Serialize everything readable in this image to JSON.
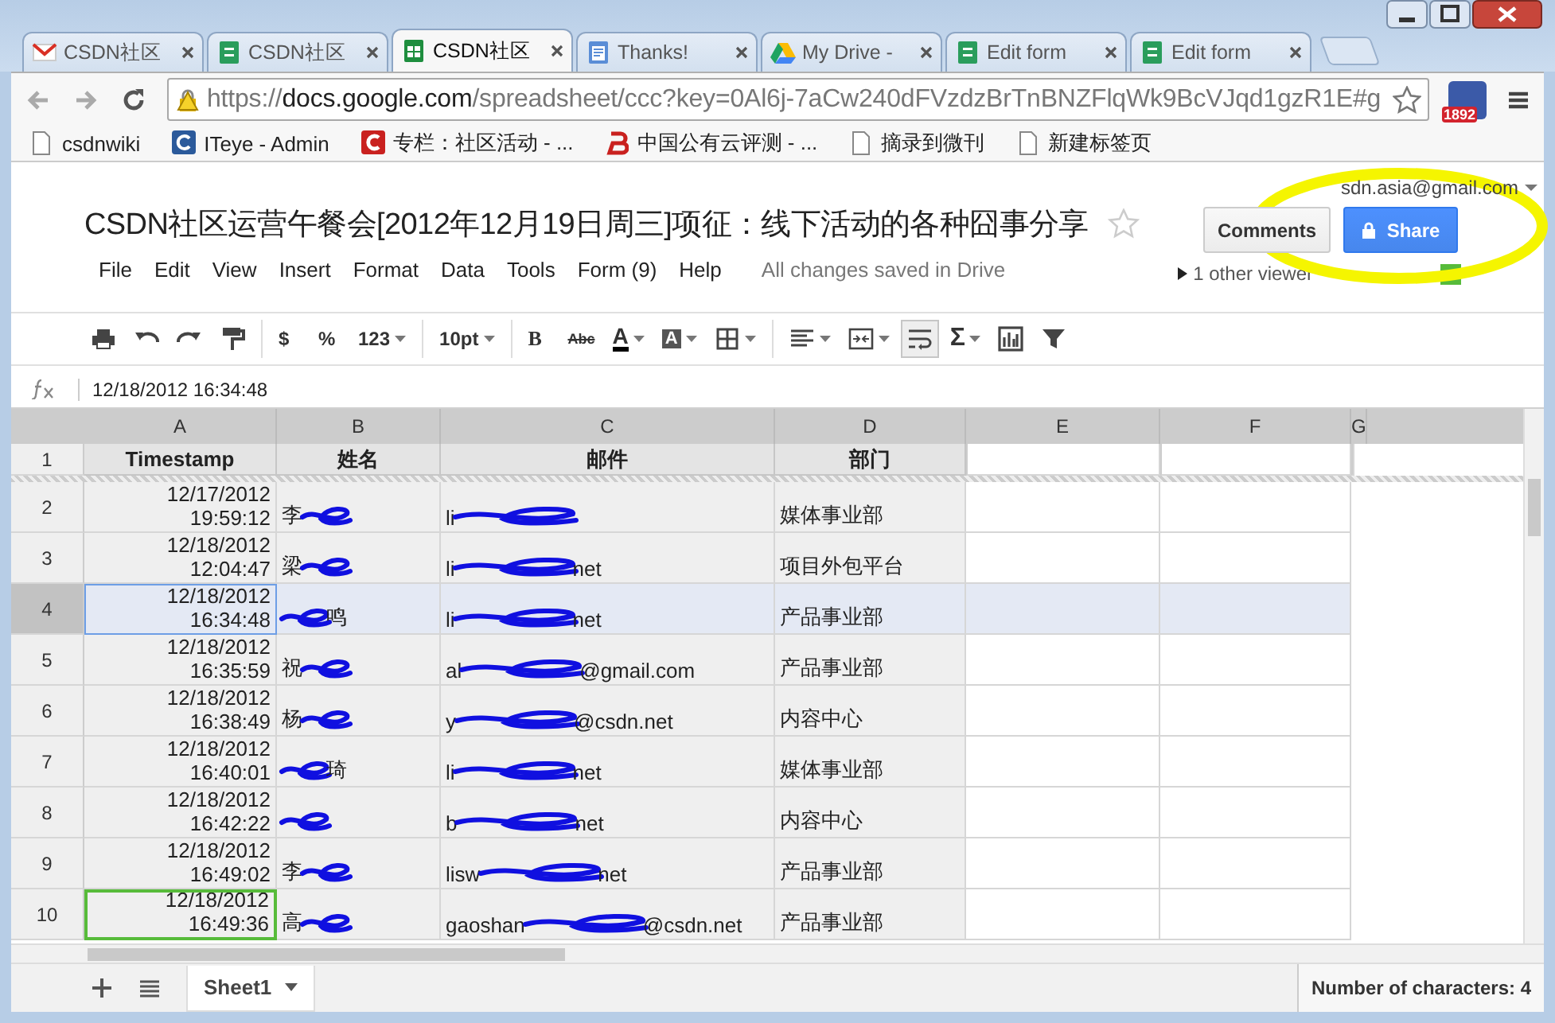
{
  "browser": {
    "tabs": [
      {
        "kind": "gmail",
        "label": "CSDN社区",
        "selected": false
      },
      {
        "kind": "forms",
        "label": "CSDN社区",
        "selected": false
      },
      {
        "kind": "sheets",
        "label": "CSDN社区",
        "selected": true
      },
      {
        "kind": "docs",
        "label": "Thanks!",
        "selected": false
      },
      {
        "kind": "drive",
        "label": "My Drive -",
        "selected": false
      },
      {
        "kind": "forms",
        "label": "Edit form",
        "selected": false
      },
      {
        "kind": "forms",
        "label": "Edit form",
        "selected": false
      }
    ],
    "url_scheme": "https://",
    "url_host": "docs.google.com",
    "url_path": "/spreadsheet/ccc?key=0Al6j-7aCw240dFVzdzBrTnBNZFlqWk9BcVJqd1gzR1E#g",
    "extension_badge": "1892",
    "bookmarks": [
      {
        "kind": "page",
        "label": "csdnwiki"
      },
      {
        "kind": "iteye",
        "label": "ITeye - Admin"
      },
      {
        "kind": "csdn",
        "label": "专栏：社区活动 - ..."
      },
      {
        "kind": "b",
        "label": "中国公有云评测 - ..."
      },
      {
        "kind": "page",
        "label": "摘录到微刊"
      },
      {
        "kind": "page",
        "label": "新建标签页"
      }
    ]
  },
  "docs": {
    "account": "sdn.asia@gmail.com",
    "title": "CSDN社区运营午餐会[2012年12月19日周三]项征：线下活动的各种囧事分享",
    "comments_button": "Comments",
    "share_button": "Share",
    "menus": [
      "File",
      "Edit",
      "View",
      "Insert",
      "Format",
      "Data",
      "Tools",
      "Form (9)",
      "Help"
    ],
    "save_status": "All changes saved in Drive",
    "viewers": "1 other viewer"
  },
  "toolbar": [
    [
      {
        "kind": "print",
        "pressed": false
      },
      {
        "kind": "undo",
        "pressed": false
      },
      {
        "kind": "redo",
        "pressed": false
      },
      {
        "kind": "paint",
        "pressed": false
      }
    ],
    [
      {
        "kind": "text",
        "label": "$",
        "pressed": false
      },
      {
        "kind": "text",
        "label": "%",
        "pressed": false
      },
      {
        "kind": "dropdown",
        "label": "123",
        "pressed": false
      }
    ],
    [
      {
        "kind": "dropdown",
        "label": "10pt",
        "pressed": false
      }
    ],
    [
      {
        "kind": "bold",
        "label": "B",
        "pressed": false
      },
      {
        "kind": "strike",
        "label": "Abc",
        "pressed": false
      },
      {
        "kind": "textcolor",
        "label": "A",
        "pressed": false
      },
      {
        "kind": "fillcolor",
        "label": "A",
        "pressed": false
      },
      {
        "kind": "borders",
        "pressed": false
      }
    ],
    [
      {
        "kind": "align",
        "pressed": false
      },
      {
        "kind": "merge",
        "pressed": false
      },
      {
        "kind": "wrap",
        "pressed": true
      },
      {
        "kind": "sum",
        "label": "Σ",
        "pressed": false
      },
      {
        "kind": "chart",
        "pressed": false
      },
      {
        "kind": "filter",
        "pressed": false
      }
    ]
  ],
  "formula_bar": {
    "value": "12/18/2012 16:34:48"
  },
  "sheet": {
    "columns": [
      "A",
      "B",
      "C",
      "D",
      "E",
      "F",
      "G"
    ],
    "header_row": {
      "number": "1",
      "cells": [
        "Timestamp",
        "姓名",
        "邮件",
        "部门"
      ]
    },
    "rows": [
      {
        "number": "2",
        "date": "12/17/2012",
        "time": "19:59:12",
        "name": {
          "before": "李"
        },
        "email": {
          "before": "li"
        },
        "department": "媒体事业部",
        "selected": false,
        "viewer_cursor": false
      },
      {
        "number": "3",
        "date": "12/18/2012",
        "time": "12:04:47",
        "name": {
          "before": "梁"
        },
        "email": {
          "before": "li",
          "after": "net"
        },
        "department": "项目外包平台",
        "selected": false,
        "viewer_cursor": false
      },
      {
        "number": "4",
        "date": "12/18/2012",
        "time": "16:34:48",
        "name": {
          "after": "鸣"
        },
        "email": {
          "before": "li",
          "after": "net"
        },
        "department": "产品事业部",
        "selected": true,
        "viewer_cursor": false
      },
      {
        "number": "5",
        "date": "12/18/2012",
        "time": "16:35:59",
        "name": {
          "before": "祝"
        },
        "email": {
          "before": "al",
          "after": "@gmail.com"
        },
        "department": "产品事业部",
        "selected": false,
        "viewer_cursor": false
      },
      {
        "number": "6",
        "date": "12/18/2012",
        "time": "16:38:49",
        "name": {
          "before": "杨"
        },
        "email": {
          "before": "y",
          "after": "@csdn.net"
        },
        "department": "内容中心",
        "selected": false,
        "viewer_cursor": false
      },
      {
        "number": "7",
        "date": "12/18/2012",
        "time": "16:40:01",
        "name": {
          "after": "琦"
        },
        "email": {
          "before": "li",
          "after": "net"
        },
        "department": "媒体事业部",
        "selected": false,
        "viewer_cursor": false
      },
      {
        "number": "8",
        "date": "12/18/2012",
        "time": "16:42:22",
        "name": {},
        "email": {
          "before": "b",
          "after": "net"
        },
        "department": "内容中心",
        "selected": false,
        "viewer_cursor": false
      },
      {
        "number": "9",
        "date": "12/18/2012",
        "time": "16:49:02",
        "name": {
          "before": "李"
        },
        "email": {
          "before": "lisw",
          "after": "net"
        },
        "department": "产品事业部",
        "selected": false,
        "viewer_cursor": false
      },
      {
        "number": "10",
        "date": "12/18/2012",
        "time": "16:49:36",
        "name": {
          "before": "高"
        },
        "email": {
          "before": "gaoshan",
          "after": "@csdn.net"
        },
        "department": "产品事业部",
        "selected": false,
        "viewer_cursor": true
      }
    ]
  },
  "sheet_tabs": [
    {
      "label": "Sheet1",
      "selected": true
    }
  ],
  "status_bar": "Number of characters: 4"
}
